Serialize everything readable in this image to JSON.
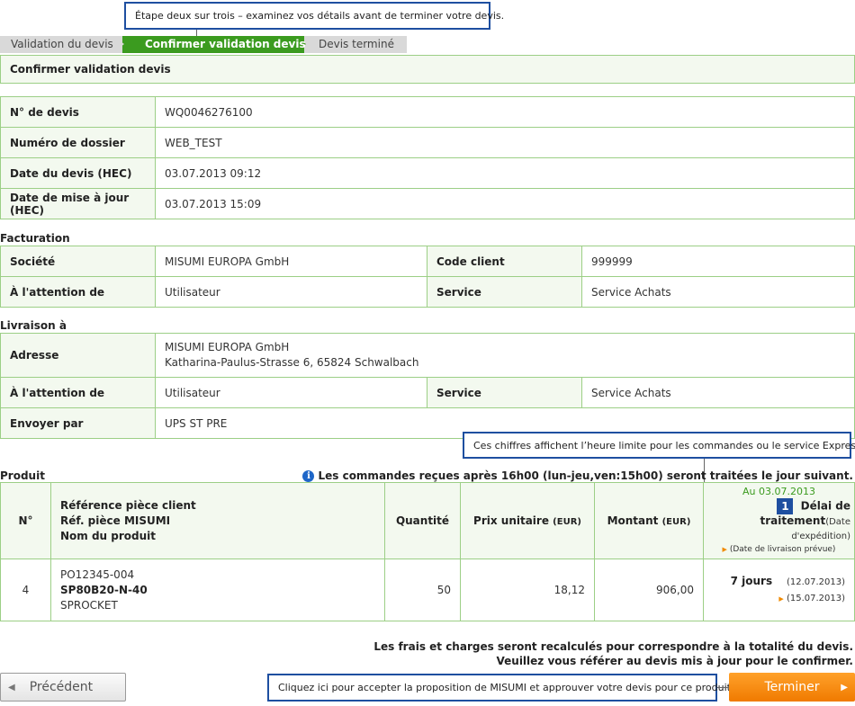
{
  "callouts": {
    "step_hint": "Étape deux sur trois – examinez vos détails avant de terminer votre devis.",
    "cutoff_hint": "Ces chiffres affichent l’heure limite pour les commandes ou le service Express.",
    "finish_hint": "Cliquez ici pour accepter la proposition de MISUMI et approuver votre devis pour ce produit."
  },
  "steps": [
    "Validation du devis",
    "Confirmer validation devis",
    "Devis terminé"
  ],
  "section_title": "Confirmer validation devis",
  "quote_info": [
    {
      "label": "N° de devis",
      "value": "WQ0046276100"
    },
    {
      "label": "Numéro de dossier",
      "value": "WEB_TEST"
    },
    {
      "label": "Date du devis (HEC)",
      "value": "03.07.2013 09:12"
    },
    {
      "label": "Date de mise à jour (HEC)",
      "value": "03.07.2013 15:09"
    }
  ],
  "billing": {
    "title": "Facturation",
    "company_label": "Société",
    "company": "MISUMI EUROPA GmbH",
    "client_code_label": "Code client",
    "client_code": "999999",
    "attention_label": "À l'attention de",
    "attention": "Utilisateur",
    "service_label": "Service",
    "service": "Service Achats"
  },
  "shipping": {
    "title": "Livraison à",
    "address_label": "Adresse",
    "address_line1": "MISUMI EUROPA GmbH",
    "address_line2": "Katharina-Paulus-Strasse 6, 65824 Schwalbach",
    "attention_label": "À l'attention de",
    "attention": "Utilisateur",
    "service_label": "Service",
    "service": "Service Achats",
    "send_by_label": "Envoyer par",
    "send_by": "UPS ST PRE"
  },
  "product": {
    "title": "Produit",
    "notice": "Les commandes reçues après 16h00 (lun-jeu,ven:15h00) seront traitées le jour suivant.",
    "headers": {
      "no": "N°",
      "ref_client": "Référence pièce client",
      "ref_misumi": "Réf. pièce MISUMI",
      "name": "Nom du produit",
      "quantity": "Quantité",
      "unit_price": "Prix unitaire",
      "unit_price_cur": "(EUR)",
      "amount": "Montant",
      "amount_cur": "(EUR)",
      "date_as_of": "Au 03.07.2013",
      "badge": "1",
      "lead_time": "Délai de traitement",
      "ship_date": "(Date d'expédition)",
      "delivery_date": "(Date de livraison prévue)"
    },
    "rows": [
      {
        "no": "4",
        "ref_client": "PO12345-004",
        "ref_misumi": "SP80B20-N-40",
        "name": "SPROCKET",
        "quantity": "50",
        "unit_price": "18,12",
        "amount": "906,00",
        "days": "7 jours",
        "ship_date": "(12.07.2013)",
        "delivery_date": "(15.07.2013)"
      }
    ]
  },
  "recalc": {
    "line1": "Les frais et charges seront recalculés pour correspondre à la totalité du devis.",
    "line2": "Veuillez vous référer au devis mis à jour pour le confirmer."
  },
  "buttons": {
    "prev": "Précédent",
    "finish": "Terminer"
  },
  "colors": {
    "green": "#3b9b1f",
    "callout_border": "#1e4fa0",
    "orange": "#f08a00"
  }
}
